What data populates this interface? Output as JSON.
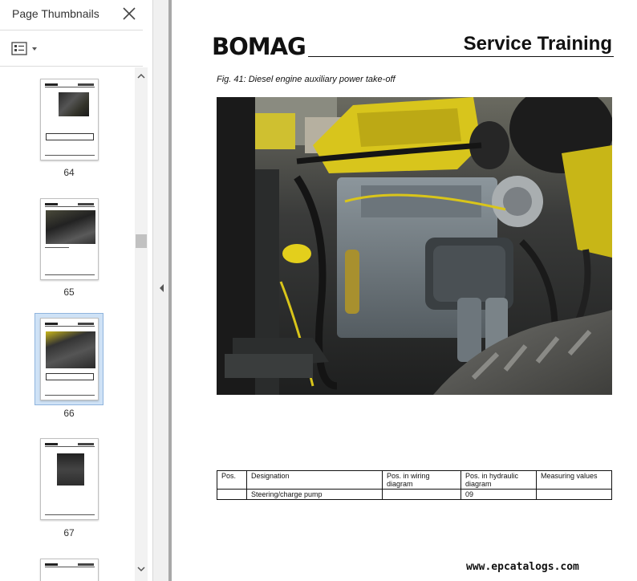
{
  "sidebar": {
    "title": "Page Thumbnails",
    "close_icon": "close-icon",
    "options_icon": "thumbnail-options-icon",
    "thumbnails": [
      {
        "label": "64",
        "selected": false
      },
      {
        "label": "65",
        "selected": false
      },
      {
        "label": "66",
        "selected": true
      },
      {
        "label": "67",
        "selected": false
      }
    ]
  },
  "document": {
    "brand": "BOMAG",
    "header_title": "Service Training",
    "figure_caption": "Fig. 41: Diesel engine auxiliary power take-off",
    "table": {
      "headers": [
        "Pos.",
        "Designation",
        "Pos. in wiring diagram",
        "Pos. in hydraulic diagram",
        "Measuring values"
      ],
      "rows": [
        [
          "",
          "Steering/charge pump",
          "",
          "09",
          ""
        ]
      ]
    },
    "watermark": "www.epcatalogs.com"
  },
  "colors": {
    "selection_fill": "#cfe2f6",
    "selection_border": "#8fb4dd",
    "engine_yellow": "#e8d21a",
    "engine_grey": "#7f8a92"
  }
}
